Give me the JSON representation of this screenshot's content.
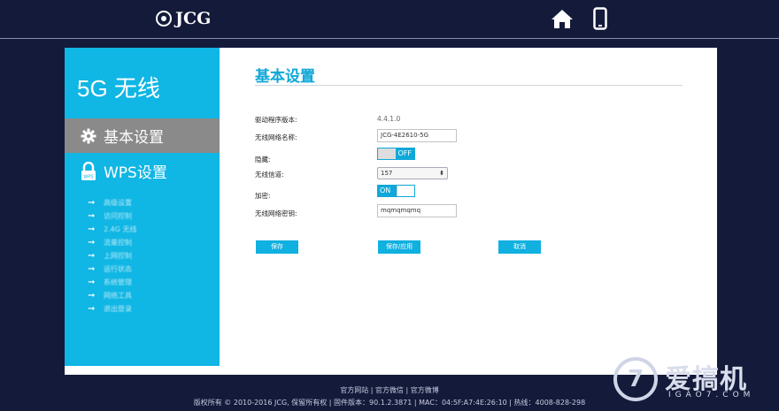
{
  "header": {
    "brand": "JCG"
  },
  "sidebar": {
    "title": "5G 无线",
    "items": [
      {
        "label": "基本设置",
        "icon": "gear-icon",
        "active": true
      },
      {
        "label": "WPS设置",
        "icon": "lock-icon",
        "active": false
      }
    ],
    "subitems": [
      "高级设置",
      "访问控制",
      "2.4G 无线",
      "流量控制",
      "上网控制",
      "运行状态",
      "系统管理",
      "网络工具",
      "退出登录"
    ]
  },
  "main": {
    "title": "基本设置",
    "fields": {
      "driver_label": "驱动程序版本:",
      "driver_value": "4.4.1.0",
      "ssid_label": "无线网络名称:",
      "ssid_value": "JCG-4E2610-5G",
      "hide_label": "隐藏:",
      "hide_toggle": "OFF",
      "channel_label": "无线信道:",
      "channel_value": "157",
      "encrypt_label": "加密:",
      "encrypt_toggle": "ON",
      "key_label": "无线网络密钥:",
      "key_value": "mqmqmqmq"
    },
    "buttons": {
      "save": "保存",
      "save_apply": "保存/应用",
      "cancel": "取消"
    }
  },
  "footer": {
    "links": "官方网站 | 官方微信 | 官方微博",
    "copyright": "版权所有 © 2010-2016 JCG, 保留所有权 | 固件版本：90.1.2.3871 | MAC：04:5F:A7:4E:26:10 | 热线：4008-828-298"
  },
  "watermark": {
    "glyph": "7",
    "cn": "爱搞机",
    "en": "IGAO7.COM"
  },
  "colors": {
    "accent": "#10b6e4",
    "background": "#141a3a",
    "active_item": "#8a8a8a"
  }
}
